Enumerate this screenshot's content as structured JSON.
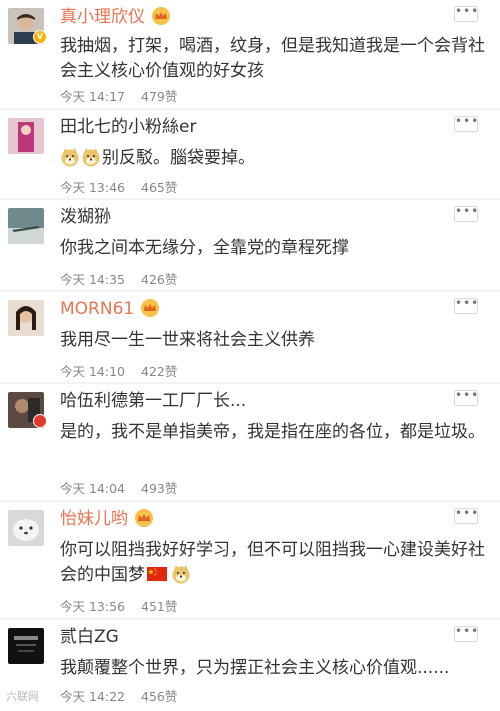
{
  "comments": [
    {
      "username": "真小理欣仪",
      "vip": true,
      "verified": true,
      "text": "我抽烟，打架，喝酒，纹身，但是我知道我是一个会背社会主义核心价值观的好女孩",
      "time": "今天 14:17",
      "likes": "479赞"
    },
    {
      "username": "田北七的小粉絲er",
      "vip": false,
      "text_pre": "",
      "text": "别反駁。腦袋要掉。",
      "emoji": [
        "doge-emoji",
        "doge-emoji"
      ],
      "time": "今天 13:46",
      "likes": "465赞"
    },
    {
      "username": "泼猢狲",
      "vip": false,
      "text": "你我之间本无缘分，全靠党的章程死撑",
      "time": "今天 14:35",
      "likes": "426赞"
    },
    {
      "username": "MORN61",
      "vip": true,
      "text": "我用尽一生一世来将社会主义供养",
      "time": "今天 14:10",
      "likes": "422赞"
    },
    {
      "username": "哈伍利德第一工厂厂长...",
      "vip": false,
      "text": "是的，我不是单指美帝，我是指在座的各位，都是垃圾。",
      "time": "今天 14:04",
      "likes": "493赞"
    },
    {
      "username": "怡妹儿哟",
      "vip": true,
      "text": "你可以阻挡我好好学习，但不可以阻挡我一心建设美好社会的中国梦",
      "emoji": [
        "china-flag-emoji",
        "doge-emoji"
      ],
      "time": "今天 13:56",
      "likes": "451赞"
    },
    {
      "username": "贰白ZG",
      "vip": false,
      "text": "我颠覆整个世界，只为摆正社会主义核心价值观......",
      "time": "今天 14:22",
      "likes": "456赞"
    }
  ],
  "more_button": "•••",
  "watermark": "六联网",
  "colors": {
    "vip_name": "#eb7350",
    "background": "#f2f2f2",
    "card": "#ffffff"
  }
}
